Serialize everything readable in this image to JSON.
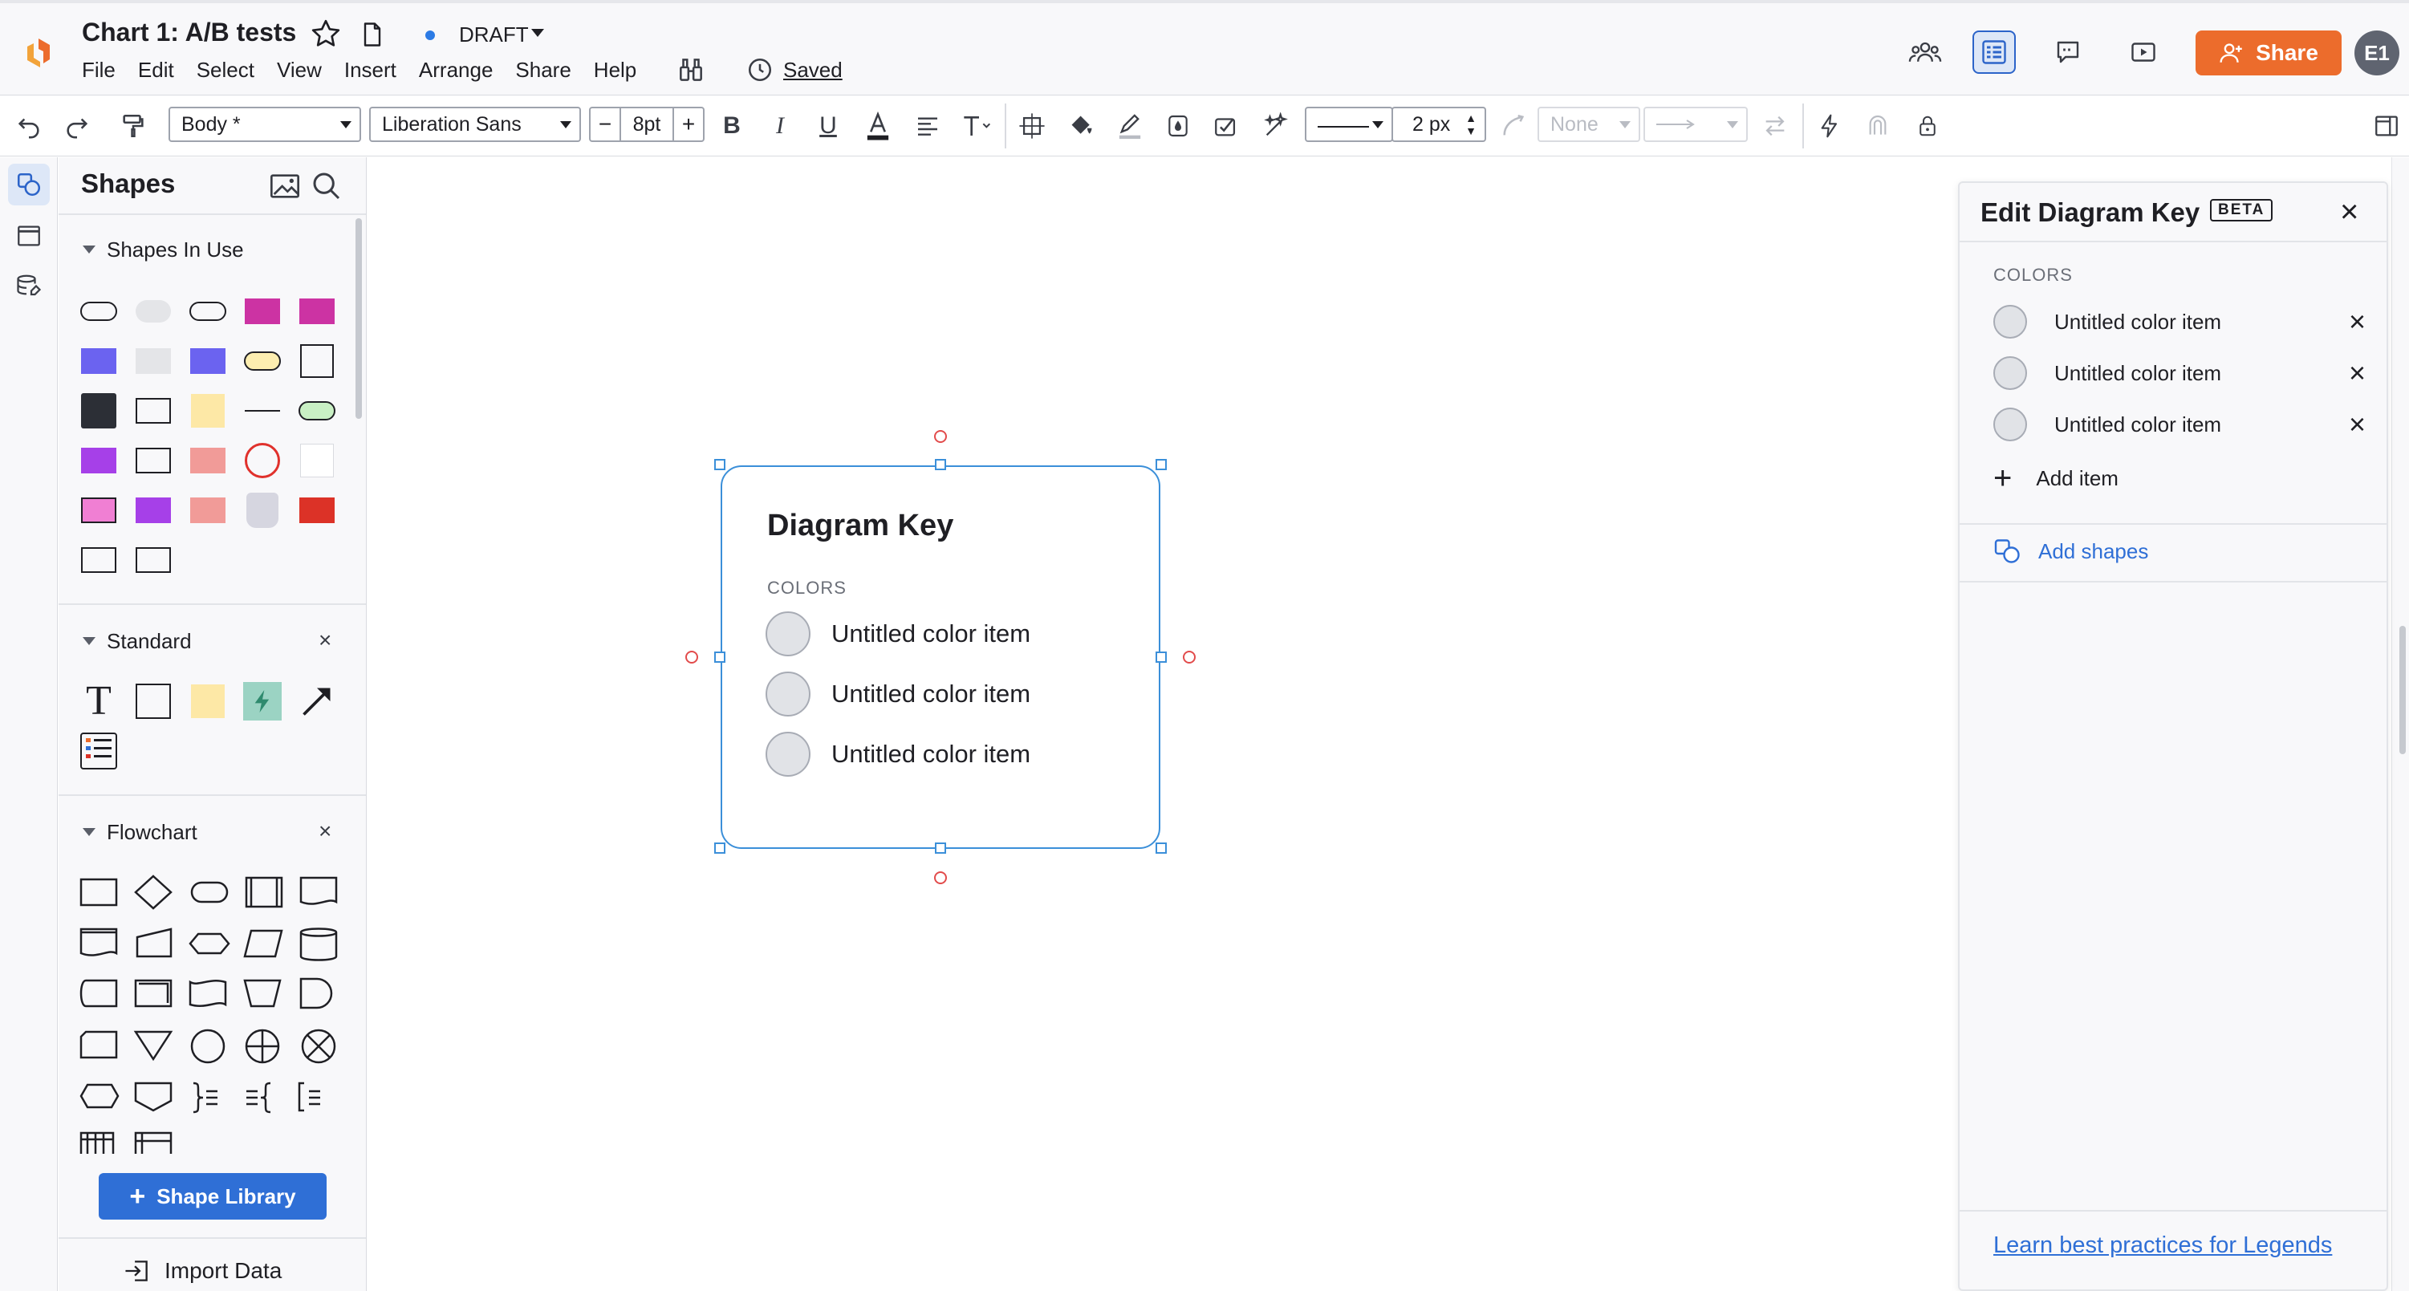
{
  "header": {
    "title": "Chart 1: A/B tests",
    "status": "DRAFT",
    "saved": "Saved",
    "menu": [
      "File",
      "Edit",
      "Select",
      "View",
      "Insert",
      "Arrange",
      "Share",
      "Help"
    ],
    "share_label": "Share",
    "avatar_initials": "E1"
  },
  "toolbar": {
    "style_select": "Body *",
    "font_select": "Liberation Sans",
    "font_size": "8pt",
    "line_width": "2 px",
    "arrow_start": "None"
  },
  "shapes_panel": {
    "title": "Shapes",
    "sections": {
      "in_use": "Shapes In Use",
      "standard": "Standard",
      "flowchart": "Flowchart"
    },
    "library_button": "Shape Library",
    "import_data": "Import Data"
  },
  "diagram_key": {
    "title": "Diagram Key",
    "colors_label": "COLORS",
    "items": [
      "Untitled color item",
      "Untitled color item",
      "Untitled color item"
    ]
  },
  "edit_key_panel": {
    "title": "Edit Diagram Key",
    "badge": "BETA",
    "colors_label": "COLORS",
    "items": [
      "Untitled color item",
      "Untitled color item",
      "Untitled color item"
    ],
    "add_item": "Add item",
    "add_shapes": "Add shapes",
    "learn_link": "Learn best practices for Legends"
  },
  "colors": {
    "accent": "#2f6fd6",
    "share_button": "#ec6c2c",
    "selection": "#3b8fd9",
    "connection_point": "#e24b4b",
    "swatch": "#e1e3e7"
  }
}
